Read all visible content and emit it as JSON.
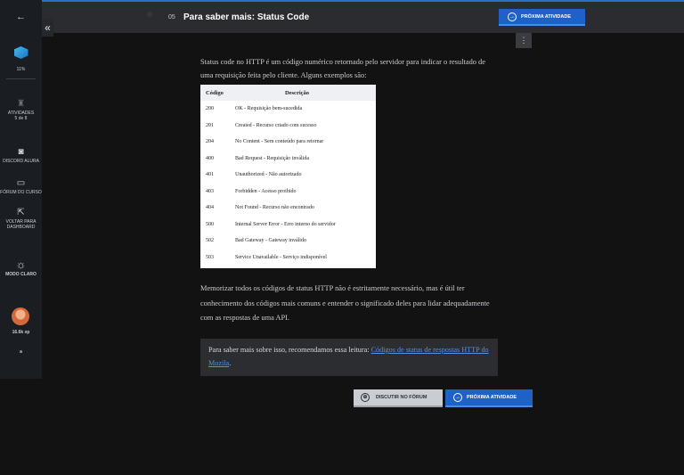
{
  "sidebar": {
    "back_icon": "←",
    "course_icon": "cube",
    "progress": "11%",
    "activities_label": "ATIVIDADES",
    "activities_count": "5 de 8",
    "discord_label": "DISCORD ALURA",
    "forum_label": "FÓRUM DO CURSO",
    "dashboard_label": "VOLTAR PARA DASHBOARD",
    "mode_label": "MODO CLARO",
    "xp": "16.6k xp",
    "logo": "a",
    "collapse_icon": "«"
  },
  "header": {
    "search_icon": "search-icon",
    "lesson_number": "05",
    "title": "Para saber mais: Status Code",
    "next_button": "PRÓXIMA ATIVIDADE",
    "kebab": "⋮"
  },
  "content": {
    "intro": "Status code no HTTP é um código numérico retornado pelo servidor para indicar o resultado de uma requisição feita pelo cliente. Alguns exemplos são:",
    "table": {
      "headers": [
        "Código",
        "Descrição"
      ],
      "rows": [
        {
          "code": "200",
          "desc": "OK - Requisição bem-sucedida"
        },
        {
          "code": "201",
          "desc": "Created - Recurso criado com sucesso"
        },
        {
          "code": "204",
          "desc": "No Content - Sem conteúdo para retornar"
        },
        {
          "code": "400",
          "desc": "Bad Request - Requisição inválida"
        },
        {
          "code": "401",
          "desc": "Unauthorized - Não autorizado"
        },
        {
          "code": "403",
          "desc": "Forbidden - Acesso proibido"
        },
        {
          "code": "404",
          "desc": "Not Found - Recurso não encontrado"
        },
        {
          "code": "500",
          "desc": "Internal Server Error - Erro interno do servidor"
        },
        {
          "code": "502",
          "desc": "Bad Gateway - Gateway inválido"
        },
        {
          "code": "503",
          "desc": "Service Unavailable - Serviço indisponível"
        }
      ]
    },
    "paragraph2": "Memorizar todos os códigos de status HTTP não é estritamente necessário, mas é útil ter conhecimento dos códigos mais comuns e entender o significado deles para lidar adequadamente com as respostas de uma API.",
    "callout_text": "Para saber mais sobre isso, recomendamos essa leitura: ",
    "callout_link": "Códigos de status de respostas HTTP do Mozila",
    "callout_end": "."
  },
  "footer_buttons": {
    "forum": "DISCUTIR NO FÓRUM",
    "next": "PRÓXIMA ATIVIDADE"
  },
  "colors": {
    "accent": "#1e62c8",
    "link": "#4f93e6",
    "background": "#121212",
    "topbar": "#2a2c30"
  }
}
